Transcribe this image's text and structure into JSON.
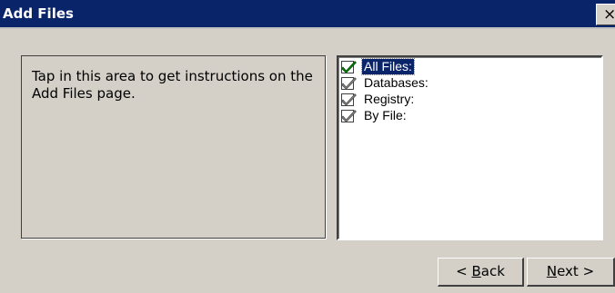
{
  "window": {
    "title": "Add Files",
    "close_glyph": "×"
  },
  "instructions": {
    "text": "Tap in this area to get instructions on the Add Files page."
  },
  "file_list": {
    "items": [
      {
        "label": "All Files:",
        "checked": true,
        "selected": true,
        "check_color": "#008000"
      },
      {
        "label": "Databases:",
        "checked": true,
        "selected": false,
        "check_color": "#808080"
      },
      {
        "label": "Registry:",
        "checked": true,
        "selected": false,
        "check_color": "#808080"
      },
      {
        "label": "By File:",
        "checked": true,
        "selected": false,
        "check_color": "#808080"
      }
    ]
  },
  "buttons": {
    "back": {
      "prefix": "< ",
      "mnemonic": "B",
      "rest": "ack"
    },
    "next": {
      "mnemonic": "N",
      "rest": "ext >"
    }
  },
  "colors": {
    "titlebar": "#0a246a",
    "face": "#d4d0c8",
    "selection": "#0a246a"
  }
}
